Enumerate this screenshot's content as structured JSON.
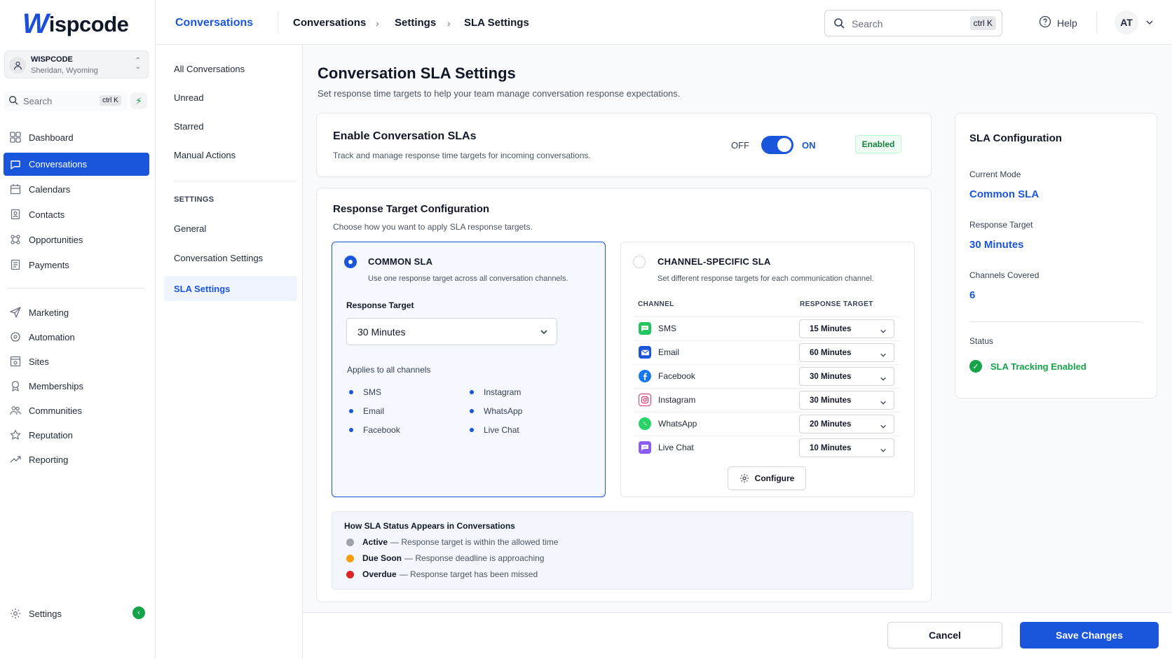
{
  "brand": {
    "logo_letter": "W",
    "logo_text": "ispcode"
  },
  "account": {
    "name": "WISPCODE",
    "location": "Sheridan, Wyoming"
  },
  "sidebar": {
    "search_placeholder": "Search",
    "search_shortcut": "ctrl K",
    "items": [
      {
        "label": "Dashboard",
        "icon": "dashboard-icon"
      },
      {
        "label": "Conversations",
        "icon": "chat-icon",
        "active": true
      },
      {
        "label": "Calendars",
        "icon": "calendar-icon"
      },
      {
        "label": "Contacts",
        "icon": "contacts-icon"
      },
      {
        "label": "Opportunities",
        "icon": "opportunities-icon"
      },
      {
        "label": "Payments",
        "icon": "payments-icon"
      },
      {
        "label": "Marketing",
        "icon": "send-icon"
      },
      {
        "label": "Automation",
        "icon": "automation-icon"
      },
      {
        "label": "Sites",
        "icon": "sites-icon"
      },
      {
        "label": "Memberships",
        "icon": "membership-icon"
      },
      {
        "label": "Communities",
        "icon": "communities-icon"
      },
      {
        "label": "Reputation",
        "icon": "star-icon"
      },
      {
        "label": "Reporting",
        "icon": "trend-icon"
      }
    ],
    "settings_label": "Settings"
  },
  "header": {
    "section": "Conversations",
    "breadcrumb": [
      "Conversations",
      "Settings",
      "SLA Settings"
    ],
    "search_placeholder": "Search",
    "search_shortcut": "ctrl K",
    "help_label": "Help",
    "avatar_initials": "AT"
  },
  "subnav": {
    "items": [
      "All Conversations",
      "Unread",
      "Starred",
      "Manual Actions"
    ],
    "settings_heading": "SETTINGS",
    "settings_items": [
      "General",
      "Conversation Settings",
      "SLA Settings"
    ]
  },
  "page": {
    "title": "Conversation SLA Settings",
    "subtitle": "Set response time targets to help your team manage conversation response expectations."
  },
  "enable_card": {
    "title": "Enable Conversation SLAs",
    "description": "Track and manage response time targets for incoming conversations.",
    "off_label": "OFF",
    "on_label": "ON",
    "state": "on",
    "badge": "Enabled"
  },
  "config_card": {
    "title": "Response Target Configuration",
    "description": "Choose how you want to apply SLA response targets.",
    "common": {
      "title": "COMMON SLA",
      "description": "Use one response target across all conversation channels.",
      "selected": true,
      "target_label": "Response Target",
      "target_value": "30 Minutes",
      "applies_label": "Applies to all channels",
      "channels_col1": [
        "SMS",
        "Email",
        "Facebook"
      ],
      "channels_col2": [
        "Instagram",
        "WhatsApp",
        "Live Chat"
      ]
    },
    "specific": {
      "title": "CHANNEL-SPECIFIC SLA",
      "description": "Set different response targets for each communication channel.",
      "selected": false,
      "col_channel": "CHANNEL",
      "col_target": "RESPONSE TARGET",
      "rows": [
        {
          "channel": "SMS",
          "target": "15 Minutes",
          "icon": "sms-icon",
          "color": "#22c55e"
        },
        {
          "channel": "Email",
          "target": "60 Minutes",
          "icon": "email-icon",
          "color": "#1a56db"
        },
        {
          "channel": "Facebook",
          "target": "30 Minutes",
          "icon": "facebook-icon",
          "color": "#1877f2"
        },
        {
          "channel": "Instagram",
          "target": "30 Minutes",
          "icon": "instagram-icon",
          "color": "#e1306c"
        },
        {
          "channel": "WhatsApp",
          "target": "20 Minutes",
          "icon": "whatsapp-icon",
          "color": "#25d366"
        },
        {
          "channel": "Live Chat",
          "target": "10 Minutes",
          "icon": "live-chat-icon",
          "color": "#8b5cf6"
        }
      ],
      "configure_label": "Configure"
    },
    "legend": {
      "title": "How SLA Status Appears in Conversations",
      "items": [
        {
          "name": "Active",
          "text": "— Response target is within the allowed time",
          "color": "#9ca3af"
        },
        {
          "name": "Due Soon",
          "text": "— Response deadline is approaching",
          "color": "#f59e0b"
        },
        {
          "name": "Overdue",
          "text": "— Response target has been missed",
          "color": "#dc2626"
        }
      ]
    }
  },
  "summary": {
    "title": "SLA Configuration",
    "mode_label": "Current Mode",
    "mode_value": "Common SLA",
    "target_label": "Response Target",
    "target_value": "30 Minutes",
    "channels_label": "Channels Covered",
    "channels_value": "6",
    "status_label": "Status",
    "status_value": "SLA Tracking Enabled"
  },
  "footer": {
    "cancel_label": "Cancel",
    "save_label": "Save Changes"
  },
  "colors": {
    "accent": "#1a56db",
    "success": "#16a34a"
  }
}
